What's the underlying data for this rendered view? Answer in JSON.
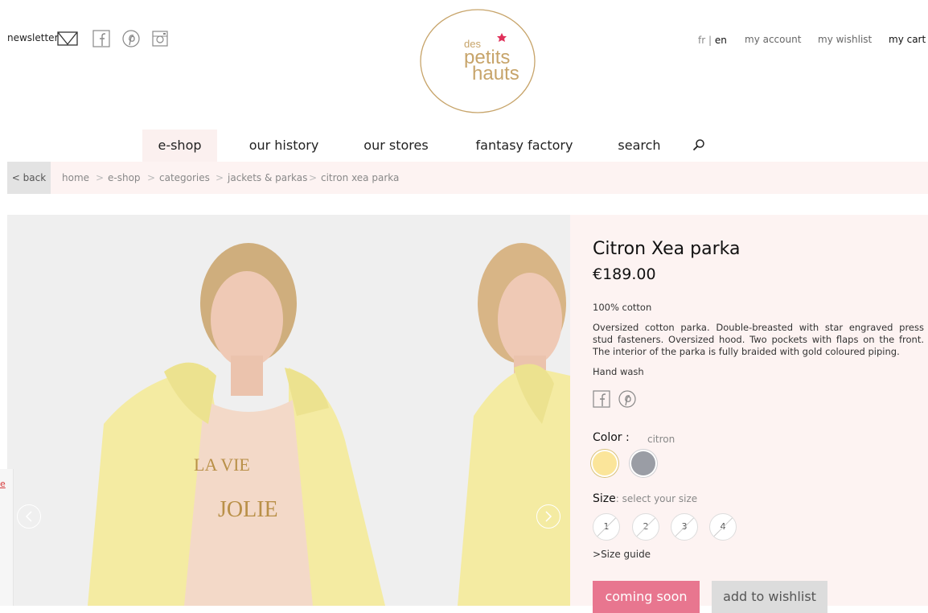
{
  "header": {
    "newsletter_label": "newsletter",
    "icons": [
      "mail-icon",
      "facebook-icon",
      "pinterest-icon",
      "instagram-icon"
    ],
    "lang_fr": "fr",
    "lang_sep": "|",
    "lang_en": "en",
    "my_account": "my account",
    "my_wishlist": "my wishlist",
    "my_cart": "my cart"
  },
  "logo": {
    "line1": "des",
    "line2": "petits",
    "line3": "hauts"
  },
  "mainnav": {
    "items": [
      "e-shop",
      "our history",
      "our stores",
      "fantasy factory",
      "search"
    ],
    "active": "e-shop"
  },
  "breadcrumb": {
    "back": "< back",
    "items": [
      "home",
      "e-shop",
      "categories",
      "jackets & parkas",
      "citron xea parka"
    ],
    "separator": ">"
  },
  "leftstrip": {
    "text": "e"
  },
  "product": {
    "title": "Citron Xea parka",
    "price": "€189.00",
    "composition": "100% cotton",
    "description": "Oversized cotton parka. Double-breasted with star engraved press stud fasteners. Oversized hood. Two pockets with flaps on the front. The interior of the parka is fully braided with gold coloured piping.",
    "care": "Hand wash",
    "color_label": "Color :",
    "color_value": "citron",
    "swatches": [
      "#fbe59a",
      "#9a9da5"
    ],
    "size_label": "Size",
    "size_hint": ": select your size",
    "sizes": [
      "1",
      "2",
      "3",
      "4"
    ],
    "size_guide": "Size guide",
    "coming_soon": "coming soon",
    "add_wishlist": "add to wishlist"
  },
  "colors": {
    "accent_pink": "#e8768f",
    "panel_bg": "#fdf3f2",
    "logo_gold": "#c7a46a",
    "logo_star": "#e0305a"
  }
}
